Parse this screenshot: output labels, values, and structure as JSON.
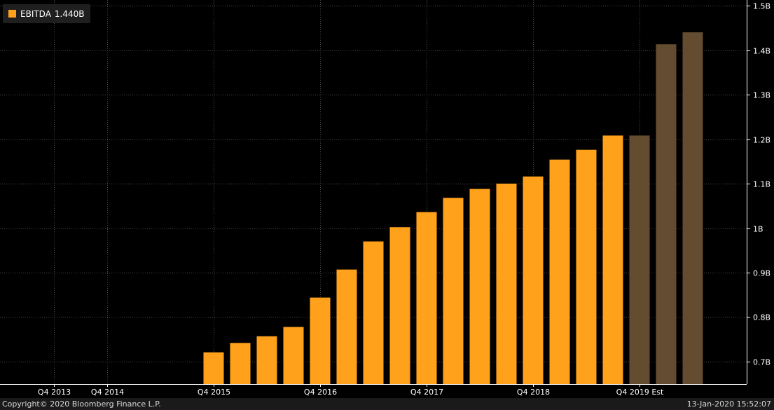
{
  "colors": {
    "background": "#000000",
    "actual_bar": "#ffa11a",
    "estimate_bar": "#634c30",
    "grid": "#4a4a4a",
    "axis_text": "#ffffff",
    "legend_bg": "#1f1f1f",
    "footer_bg": "#1a1a1a"
  },
  "legend": {
    "label": "EBITDA",
    "value": "1.440B"
  },
  "footer": {
    "copyright": "Copyright© 2020 Bloomberg Finance L.P.",
    "timestamp": "13-Jan-2020 15:52:07"
  },
  "chart_data": {
    "type": "bar",
    "title": "",
    "xlabel": "",
    "ylabel": "",
    "ylim": [
      0.65,
      1.5
    ],
    "y_ticks": [
      {
        "value": 0.7,
        "label": "0.7B"
      },
      {
        "value": 0.8,
        "label": "0.8B"
      },
      {
        "value": 0.9,
        "label": "0.9B"
      },
      {
        "value": 1.0,
        "label": "1B"
      },
      {
        "value": 1.1,
        "label": "1.1B"
      },
      {
        "value": 1.2,
        "label": "1.2B"
      },
      {
        "value": 1.3,
        "label": "1.3B"
      },
      {
        "value": 1.4,
        "label": "1.4B"
      },
      {
        "value": 1.5,
        "label": "1.5B"
      }
    ],
    "x_ticks": [
      {
        "slot": 0,
        "label": "Q4 2013"
      },
      {
        "slot": 2,
        "label": "Q4 2014"
      },
      {
        "slot": 6,
        "label": "Q4 2015"
      },
      {
        "slot": 10,
        "label": "Q4 2016"
      },
      {
        "slot": 14,
        "label": "Q4 2017"
      },
      {
        "slot": 18,
        "label": "Q4 2018"
      },
      {
        "slot": 22,
        "label": "Q4 2019 Est"
      }
    ],
    "grid": true,
    "legend_position": "top-left",
    "slot_count": 26,
    "series": [
      {
        "name": "EBITDA",
        "bars": [
          {
            "slot": 6,
            "value": 0.721,
            "estimate": false
          },
          {
            "slot": 7,
            "value": 0.742,
            "estimate": false
          },
          {
            "slot": 8,
            "value": 0.757,
            "estimate": false
          },
          {
            "slot": 9,
            "value": 0.778,
            "estimate": false
          },
          {
            "slot": 10,
            "value": 0.844,
            "estimate": false
          },
          {
            "slot": 11,
            "value": 0.907,
            "estimate": false
          },
          {
            "slot": 12,
            "value": 0.97,
            "estimate": false
          },
          {
            "slot": 13,
            "value": 1.002,
            "estimate": false
          },
          {
            "slot": 14,
            "value": 1.036,
            "estimate": false
          },
          {
            "slot": 15,
            "value": 1.068,
            "estimate": false
          },
          {
            "slot": 16,
            "value": 1.088,
            "estimate": false
          },
          {
            "slot": 17,
            "value": 1.1,
            "estimate": false
          },
          {
            "slot": 18,
            "value": 1.116,
            "estimate": false
          },
          {
            "slot": 19,
            "value": 1.154,
            "estimate": false
          },
          {
            "slot": 20,
            "value": 1.176,
            "estimate": false
          },
          {
            "slot": 21,
            "value": 1.208,
            "estimate": false
          },
          {
            "slot": 22,
            "value": 1.208,
            "estimate": true
          },
          {
            "slot": 23,
            "value": 1.413,
            "estimate": true
          },
          {
            "slot": 24,
            "value": 1.44,
            "estimate": true
          }
        ]
      }
    ]
  }
}
